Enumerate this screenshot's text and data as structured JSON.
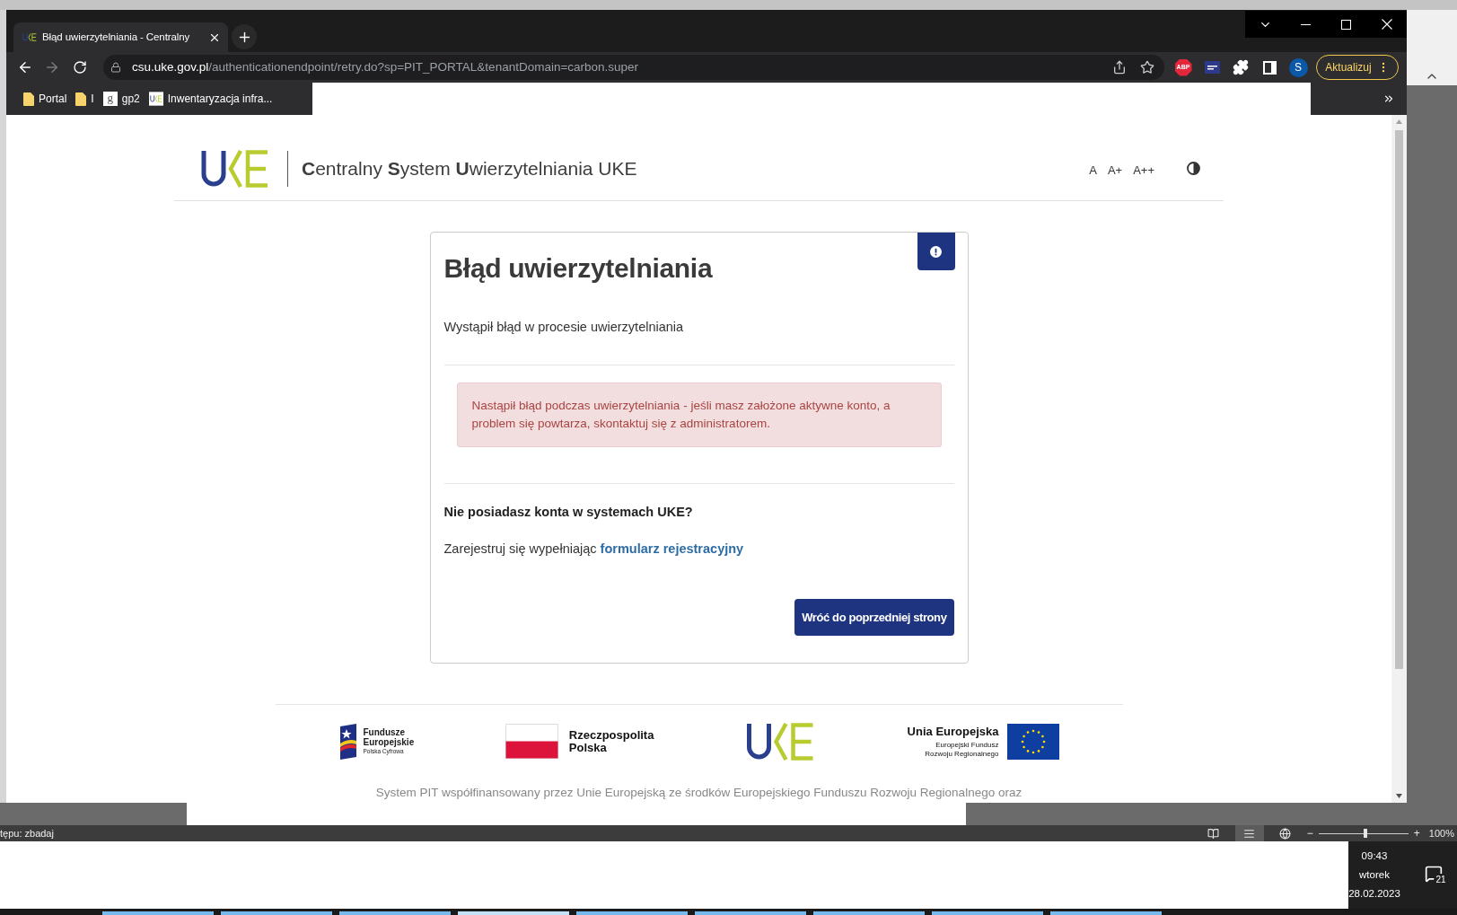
{
  "browser": {
    "tabs": [
      {
        "title": "Błąd uwierzytelniania - Centralny",
        "selected": true
      }
    ],
    "address": {
      "host": "csu.uke.gov.pl",
      "path": "/authenticationendpoint/retry.do?sp=PIT_PORTAL&tenantDomain=carbon.super"
    },
    "extensions": [
      {
        "kind": "badge",
        "label": "ABP"
      },
      {
        "kind": "card"
      },
      {
        "kind": "puzzle"
      },
      {
        "kind": "sidebar"
      }
    ],
    "profile": "S",
    "update_button": "Aktualizuj",
    "bookmarks": [
      {
        "kind": "folder",
        "label": "Portal"
      },
      {
        "kind": "folder",
        "label": "I"
      },
      {
        "kind": "letter",
        "icon_text": "g",
        "label": "gp2"
      },
      {
        "kind": "logo",
        "label": "Inwentaryzacja infra..."
      }
    ]
  },
  "page": {
    "header": {
      "title": "**C**entralny **S**ystem **U**wierzytelniania UKE",
      "font_sizes": [
        "A",
        "A+",
        "A++"
      ]
    },
    "card": {
      "title": "Błąd uwierzytelniania",
      "message": "Wystąpił błąd w procesie uwierzytelniania",
      "alert": "Nastąpił błąd podczas uwierzytelniania - jeśli masz założone aktywne konto, a problem się powtarza, skontaktuj się z administratorem.",
      "register_heading": "Nie posiadasz konta w systemach UKE?",
      "register_text": "Zarejestruj się wypełniając",
      "register_link": "formularz rejestracyjny",
      "back_button": "Wróć do poprzedniej strony"
    },
    "footer": {
      "logos": [
        {
          "kind": "fe",
          "lines": [
            "Fundusze",
            "Europejskie",
            "Polska Cyfrowa"
          ]
        },
        {
          "kind": "rp",
          "lines": [
            "Rzeczpospolita",
            "Polska"
          ]
        },
        {
          "kind": "uke"
        },
        {
          "kind": "eu",
          "lines": [
            "Unia Europejska",
            "Europejski Fundusz",
            "Rozwoju Regionalnego"
          ]
        }
      ],
      "text": "System PIT współfinansowany przez Unie Europejską ze środków Europejskiego Funduszu Rozwoju Regionalnego oraz"
    }
  },
  "word_window": {
    "status_text": "tępu: zbadaj",
    "views": [
      {
        "kind": "read",
        "selected": false
      },
      {
        "kind": "print",
        "selected": true
      },
      {
        "kind": "web",
        "selected": false
      }
    ],
    "zoom": {
      "minus": "−",
      "plus": "+",
      "level": 0.52,
      "reading": "100%"
    }
  },
  "taskbar": {
    "buttons": [
      {
        "selected": false
      },
      {
        "selected": false
      },
      {
        "selected": false
      },
      {
        "selected": true
      },
      {
        "selected": false
      },
      {
        "selected": false
      },
      {
        "selected": false
      },
      {
        "selected": false
      },
      {
        "selected": false
      }
    ],
    "time": "09:43",
    "day": "wtorek",
    "date": "28.02.2023",
    "notifications": "21"
  }
}
